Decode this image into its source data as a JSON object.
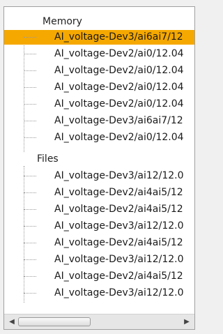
{
  "tree": {
    "groups": [
      {
        "label": "Memory",
        "items": [
          {
            "label": "AI_voltage-Dev3/ai6ai7/12",
            "selected": true
          },
          {
            "label": "AI_voltage-Dev2/ai0/12.04"
          },
          {
            "label": "AI_voltage-Dev2/ai0/12.04"
          },
          {
            "label": "AI_voltage-Dev2/ai0/12.04"
          },
          {
            "label": "AI_voltage-Dev2/ai0/12.04"
          },
          {
            "label": "AI_voltage-Dev3/ai6ai7/12"
          },
          {
            "label": "AI_voltage-Dev2/ai0/12.04"
          }
        ]
      },
      {
        "label": "Files",
        "items": [
          {
            "label": "AI_voltage-Dev3/ai12/12.0"
          },
          {
            "label": "AI_voltage-Dev2/ai4ai5/12"
          },
          {
            "label": "AI_voltage-Dev2/ai4ai5/12"
          },
          {
            "label": "AI_voltage-Dev3/ai12/12.0"
          },
          {
            "label": "AI_voltage-Dev2/ai4ai5/12"
          },
          {
            "label": "AI_voltage-Dev3/ai12/12.0"
          },
          {
            "label": "AI_voltage-Dev2/ai4ai5/12"
          },
          {
            "label": "AI_voltage-Dev3/ai12/12.0"
          }
        ]
      }
    ]
  },
  "colors": {
    "selection": "#f5a800",
    "background": "#ffffff",
    "border": "#a0a0a0"
  },
  "scrollbar": {
    "left_icon": "scroll-left-arrow-icon",
    "right_icon": "scroll-right-arrow-icon",
    "left_glyph": "◀",
    "right_glyph": "▶"
  }
}
